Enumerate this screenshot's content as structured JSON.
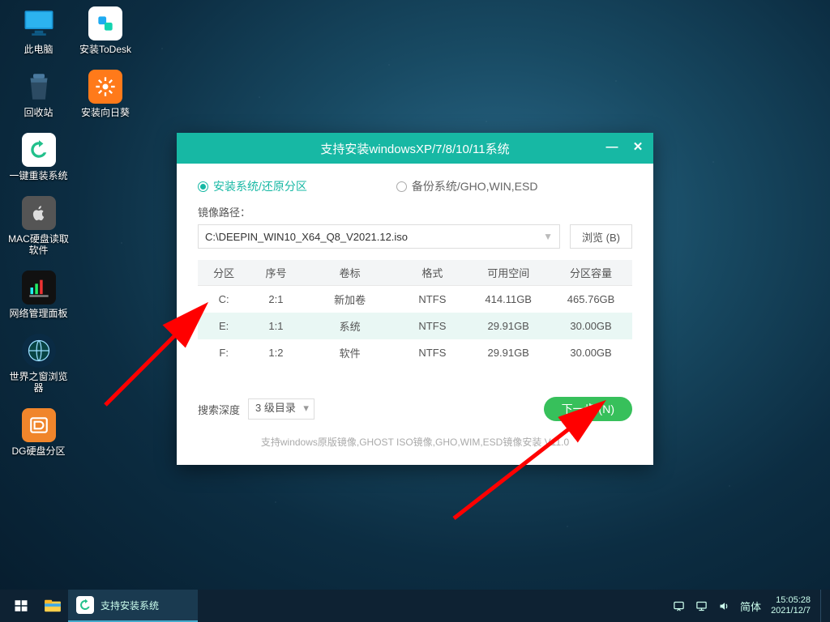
{
  "desktop": {
    "this_pc": "此电脑",
    "recycle": "回收站",
    "reinstall": "一键重装系统",
    "macdisk": "MAC硬盘读取软件",
    "netpanel": "网络管理面板",
    "worldbrowser": "世界之窗浏览器",
    "dg": "DG硬盘分区",
    "todesk": "安装ToDesk",
    "sunflower": "安装向日葵"
  },
  "win": {
    "title": "支持安装windowsXP/7/8/10/11系统",
    "tab_install": "安装系统/还原分区",
    "tab_backup": "备份系统/GHO,WIN,ESD",
    "path_label": "镜像路径：",
    "path_value": "C:\\DEEPIN_WIN10_X64_Q8_V2021.12.iso",
    "browse": "浏览 (B)",
    "cols": {
      "part": "分区",
      "seq": "序号",
      "vol": "卷标",
      "fmt": "格式",
      "free": "可用空间",
      "cap": "分区容量"
    },
    "rows": [
      {
        "part": "C:",
        "seq": "2:1",
        "vol": "新加卷",
        "fmt": "NTFS",
        "free": "414.11GB",
        "cap": "465.76GB",
        "selected": false
      },
      {
        "part": "E:",
        "seq": "1:1",
        "vol": "系统",
        "fmt": "NTFS",
        "free": "29.91GB",
        "cap": "30.00GB",
        "selected": true
      },
      {
        "part": "F:",
        "seq": "1:2",
        "vol": "软件",
        "fmt": "NTFS",
        "free": "29.91GB",
        "cap": "30.00GB",
        "selected": false
      }
    ],
    "depth_label": "搜索深度",
    "depth_value": "3 级目录",
    "next": "下一步 (N)",
    "hint": "支持windows原版镜像,GHOST ISO镜像,GHO,WIM,ESD镜像安装    V11.0"
  },
  "taskbar": {
    "app_title": "支持安装系统",
    "ime": "简体",
    "time": "15:05:28",
    "date": "2021/12/7"
  }
}
